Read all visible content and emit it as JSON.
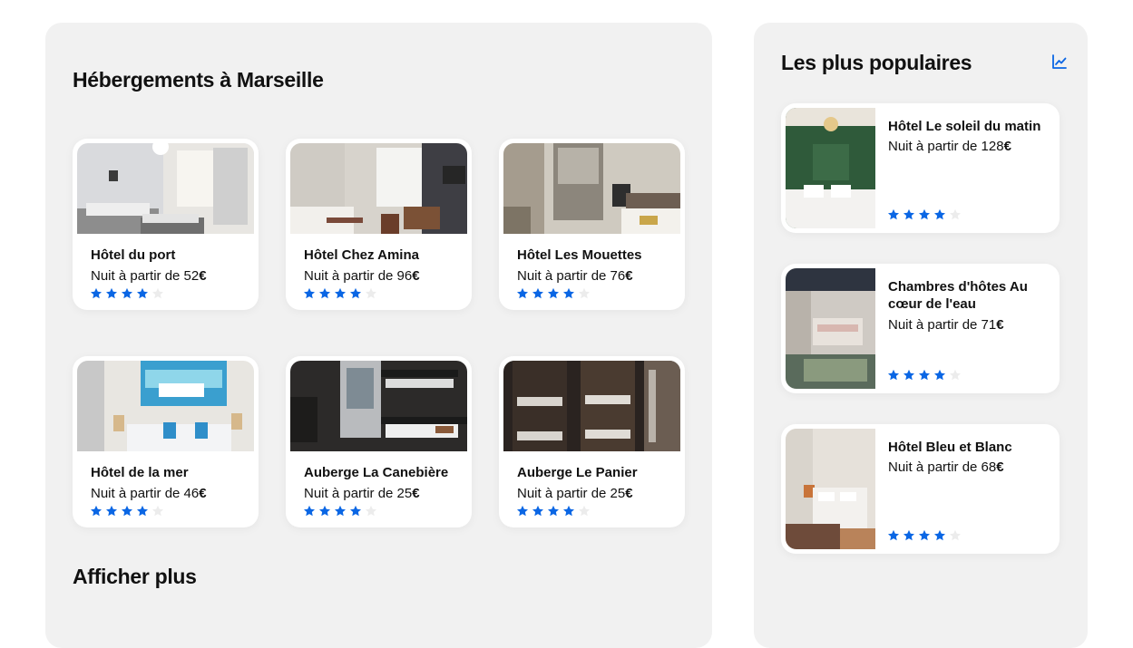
{
  "main": {
    "title": "Hébergements à Marseille",
    "more_label": "Afficher plus",
    "cards": [
      {
        "name": "Hôtel du port",
        "price_prefix": "Nuit à partir de ",
        "price_value": "52",
        "currency": "€",
        "rating": 4,
        "max_rating": 5
      },
      {
        "name": "Hôtel Chez Amina",
        "price_prefix": "Nuit à partir de ",
        "price_value": "96",
        "currency": "€",
        "rating": 4,
        "max_rating": 5
      },
      {
        "name": "Hôtel Les Mouettes",
        "price_prefix": "Nuit à partir de ",
        "price_value": "76",
        "currency": "€",
        "rating": 4,
        "max_rating": 5
      },
      {
        "name": "Hôtel de la mer",
        "price_prefix": "Nuit à partir de ",
        "price_value": "46",
        "currency": "€",
        "rating": 4,
        "max_rating": 5
      },
      {
        "name": "Auberge La Canebière",
        "price_prefix": "Nuit à partir de ",
        "price_value": "25",
        "currency": "€",
        "rating": 4,
        "max_rating": 5
      },
      {
        "name": "Auberge Le Panier",
        "price_prefix": "Nuit à partir de ",
        "price_value": "25",
        "currency": "€",
        "rating": 4,
        "max_rating": 5
      }
    ]
  },
  "popular": {
    "title": "Les plus populaires",
    "icon": "trending-chart-icon",
    "items": [
      {
        "name": "Hôtel Le soleil du matin",
        "price_prefix": "Nuit à partir de ",
        "price_value": "128",
        "currency": "€",
        "rating": 4,
        "max_rating": 5
      },
      {
        "name": "Chambres d'hôtes Au cœur de l'eau",
        "price_prefix": "Nuit à partir de ",
        "price_value": "71",
        "currency": "€",
        "rating": 4,
        "max_rating": 5
      },
      {
        "name": "Hôtel Bleu et Blanc",
        "price_prefix": "Nuit à partir de ",
        "price_value": "68",
        "currency": "€",
        "rating": 4,
        "max_rating": 5
      }
    ]
  },
  "colors": {
    "star_filled": "#0a66e4",
    "star_empty": "#ececec",
    "accent": "#0a66e4",
    "panel_bg": "#f1f1f1"
  }
}
